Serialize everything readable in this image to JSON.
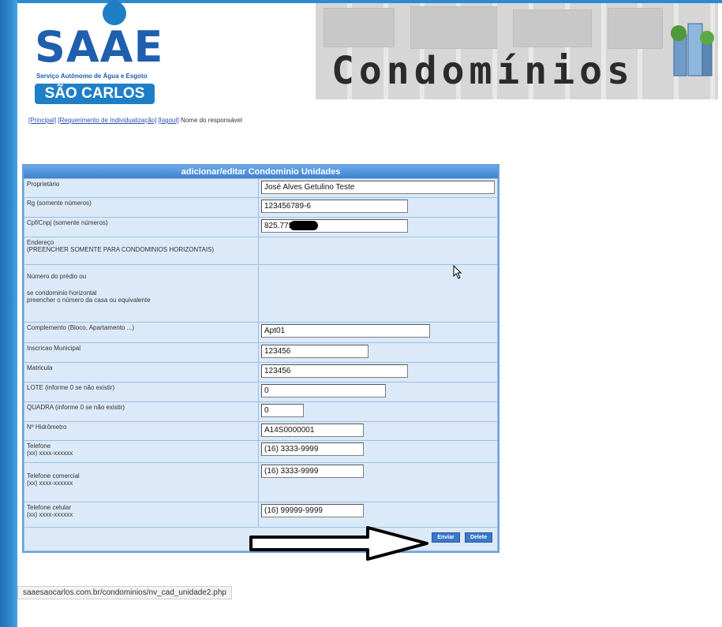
{
  "logo": {
    "name": "SAAE",
    "tagline": "Serviço Autônomo de Água e Esgoto",
    "city": "SÃO CARLOS"
  },
  "banner": {
    "title": "Condomínios"
  },
  "nav": {
    "links": [
      "[Principal]",
      "[Requerimento de Individualização]",
      "[logout]"
    ],
    "suffix": "Nome do responsável"
  },
  "form": {
    "title": "adicionar/editar Condominio Unidades",
    "fields": [
      {
        "label": "Proprietário",
        "value": "José Alves Getulino Teste"
      },
      {
        "label": "Rg (somente números)",
        "value": "123456789-6"
      },
      {
        "label": "Cpf/Cnpj (somente números)",
        "value": "825.775"
      },
      {
        "label": "Endereço",
        "label2": "(PREENCHER SOMENTE PARA CONDOMINIOS HORIZONTAIS)"
      },
      {
        "label": "Número do prédio ou",
        "label2": "se condominio horizontal",
        "label3": "preencher o número da casa ou equivalente"
      },
      {
        "label": "Complemento (Bloco, Apartamento ...)",
        "value": "Apt01"
      },
      {
        "label": "Inscricao Municipal",
        "value": "123456"
      },
      {
        "label": "Matricula",
        "value": "123456"
      },
      {
        "label": "LOTE (informe 0 se não existir)",
        "value": "0"
      },
      {
        "label": "QUADRA (informe 0 se não existir)",
        "value": "0"
      },
      {
        "label": "Nº Hidrômetro",
        "value": "A14S0000001"
      },
      {
        "label": "Telefone",
        "hint": "(xx) xxxx-xxxxxx",
        "value": "(16) 3333-9999"
      },
      {
        "label": "Telefone comercial",
        "hint": "(xx) xxxx-xxxxxx",
        "value": "(16) 3333-9999"
      },
      {
        "label": "Telefone celular",
        "hint": "(xx) xxxx-xxxxxx",
        "value": "(16) 99999-9999"
      }
    ],
    "buttons": {
      "submit": "Enviar",
      "delete": "Delete"
    }
  },
  "status_bar": {
    "url": "saaesaocarlos.com.br/condominios/nv_cad_unidade2.php"
  },
  "colors": {
    "header": "#3f82d0",
    "cell": "#dbe9f8",
    "accent": "#1f5fae"
  }
}
